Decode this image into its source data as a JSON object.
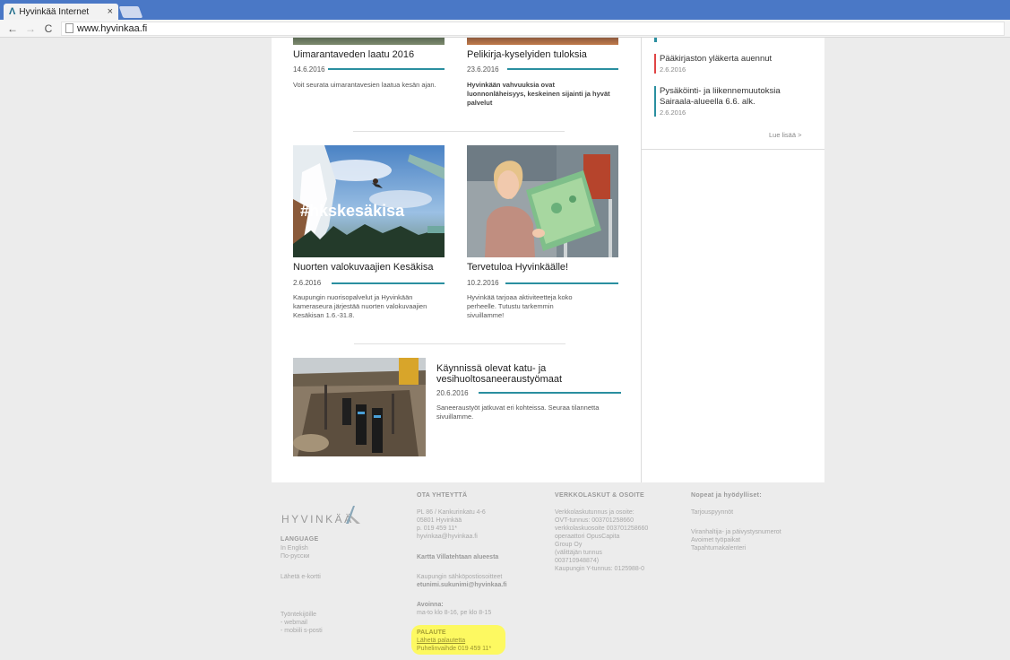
{
  "browser": {
    "tab_title": "Hyvinkää Internet",
    "tab_close": "×",
    "url": "www.hyvinkaa.fi",
    "back": "←",
    "forward": "→",
    "reload": "C"
  },
  "cards_top": [
    {
      "title": "Uimarantaveden laatu 2016",
      "date": "14.6.2016",
      "desc": "Voit seurata uimarantavesien laatua kesän ajan."
    },
    {
      "title": "Pelikirja-kyselyiden tuloksia",
      "date": "23.6.2016",
      "desc": "Hyvinkään vahvuuksia ovat luonnonläheisyys, keskeinen sijainti ja hyvät palvelut"
    }
  ],
  "cards_mid": [
    {
      "title": "Nuorten valokuvaajien Kesäkisa",
      "date": "2.6.2016",
      "desc": "Kaupungin nuorisopalvelut ja Hyvinkään kameraseura järjestää nuorten valokuvaajien Kesäkisan 1.6.-31.8.",
      "image_text": "#hkskesäkisa"
    },
    {
      "title": "Tervetuloa Hyvinkäälle!",
      "date": "10.2.2016",
      "desc": "Hyvinkää tarjoaa aktiviteetteja koko perheelle. Tutustu tarkemmin sivuillamme!"
    }
  ],
  "card_wide": {
    "title": "Käynnissä olevat katu- ja vesihuoltosaneeraustyömaat",
    "date": "20.6.2016",
    "desc": "Saneeraustyöt jatkuvat eri kohteissa. Seuraa tilannetta sivuillamme."
  },
  "sidebar": {
    "news": [
      {
        "title": "Pääkirjaston yläkerta auennut",
        "date": "2.6.2016"
      },
      {
        "title": "Pysäköinti- ja liikennemuutoksia Sairaala-alueella 6.6. alk.",
        "date": "2.6.2016"
      }
    ],
    "read_more": "Lue lisää >"
  },
  "footer": {
    "logo": "HYVINKÄÄ",
    "language_title": "LANGUAGE",
    "lang_en": "In English",
    "lang_ru": "По-русски",
    "send_card": "Lähetä e-kortti",
    "staff": "Työntekijöille",
    "webmail": "- webmail",
    "mobile": "- mobiili s-posti",
    "contact_title": "OTA YHTEYTTÄ",
    "address1": "PL 86 / Kankurinkatu 4-6",
    "address2": "05801 Hyvinkää",
    "phone": "p. 019 459 11*",
    "email": "hyvinkaa@hyvinkaa.fi",
    "map": "Kartta Villatehtaan alueesta",
    "email_format_label": "Kaupungin sähköpostiosoitteet",
    "email_format": "etunimi.sukunimi@hyvinkaa.fi",
    "open_title": "Avoinna:",
    "open_hours": "ma-to klo 8-16, pe klo 8-15",
    "feedback_title": "PALAUTE",
    "feedback_link": "Lähetä palautetta",
    "switchboard": "Puhelinvaihde 019 459 11*",
    "billing_title": "VERKKOLASKUT & OSOITE",
    "billing_1": "Verkkolaskutunnus ja osoite:",
    "billing_2": "OVT-tunnus: 003701258660",
    "billing_3": "verkkolaskuosoite 003701258660",
    "billing_4": "operaattori OpusCapita",
    "billing_5": "Group Oy",
    "billing_6": "(välittäjän tunnus",
    "billing_7": "003710948874)",
    "billing_8": "Kaupungin Y-tunnus: 0125988-0",
    "links_title": "Nopeat ja hyödylliset:",
    "link_1": "Tarjouspyynnöt",
    "link_2": "Viranhaltija- ja päivystysnumerot",
    "link_3": "Avoimet työpaikat",
    "link_4": "Tapahtumakalenteri"
  },
  "colors": {
    "accent": "#2a8fa0",
    "news_red": "#e04545",
    "highlight": "#fffb52"
  }
}
